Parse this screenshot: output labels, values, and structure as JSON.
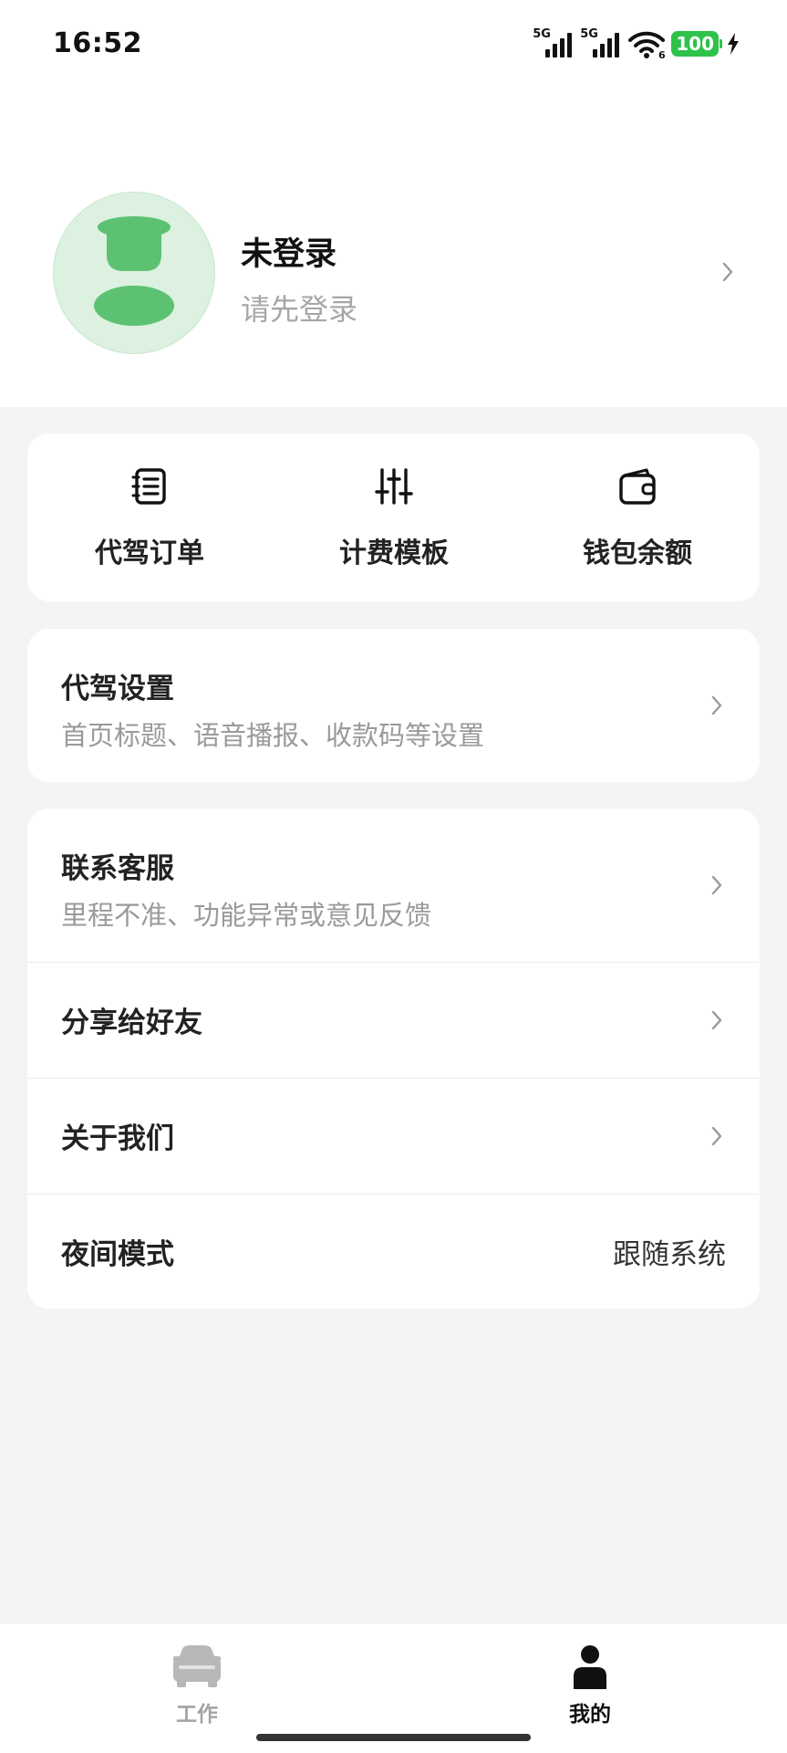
{
  "status_bar": {
    "time": "16:52",
    "sim1_label": "5G",
    "sim2_label": "5G",
    "wifi_badge": "6",
    "battery": "100"
  },
  "profile": {
    "name": "未登录",
    "subtitle": "请先登录"
  },
  "quick_actions": [
    {
      "label": "代驾订单",
      "icon": "order-list-icon"
    },
    {
      "label": "计费模板",
      "icon": "sliders-icon"
    },
    {
      "label": "钱包余额",
      "icon": "wallet-icon"
    }
  ],
  "settings": {
    "title": "代驾设置",
    "subtitle": "首页标题、语音播报、收款码等设置"
  },
  "service": {
    "support_title": "联系客服",
    "support_subtitle": "里程不准、功能异常或意见反馈",
    "share_title": "分享给好友",
    "about_title": "关于我们",
    "night_title": "夜间模式",
    "night_value": "跟随系统"
  },
  "bottom_nav": {
    "work_label": "工作",
    "mine_label": "我的",
    "active": "mine"
  },
  "colors": {
    "accent": "#5cc272",
    "avatar_bg": "#dcf1e0",
    "battery": "#2fc24b",
    "page_bg": "#f4f4f4"
  }
}
